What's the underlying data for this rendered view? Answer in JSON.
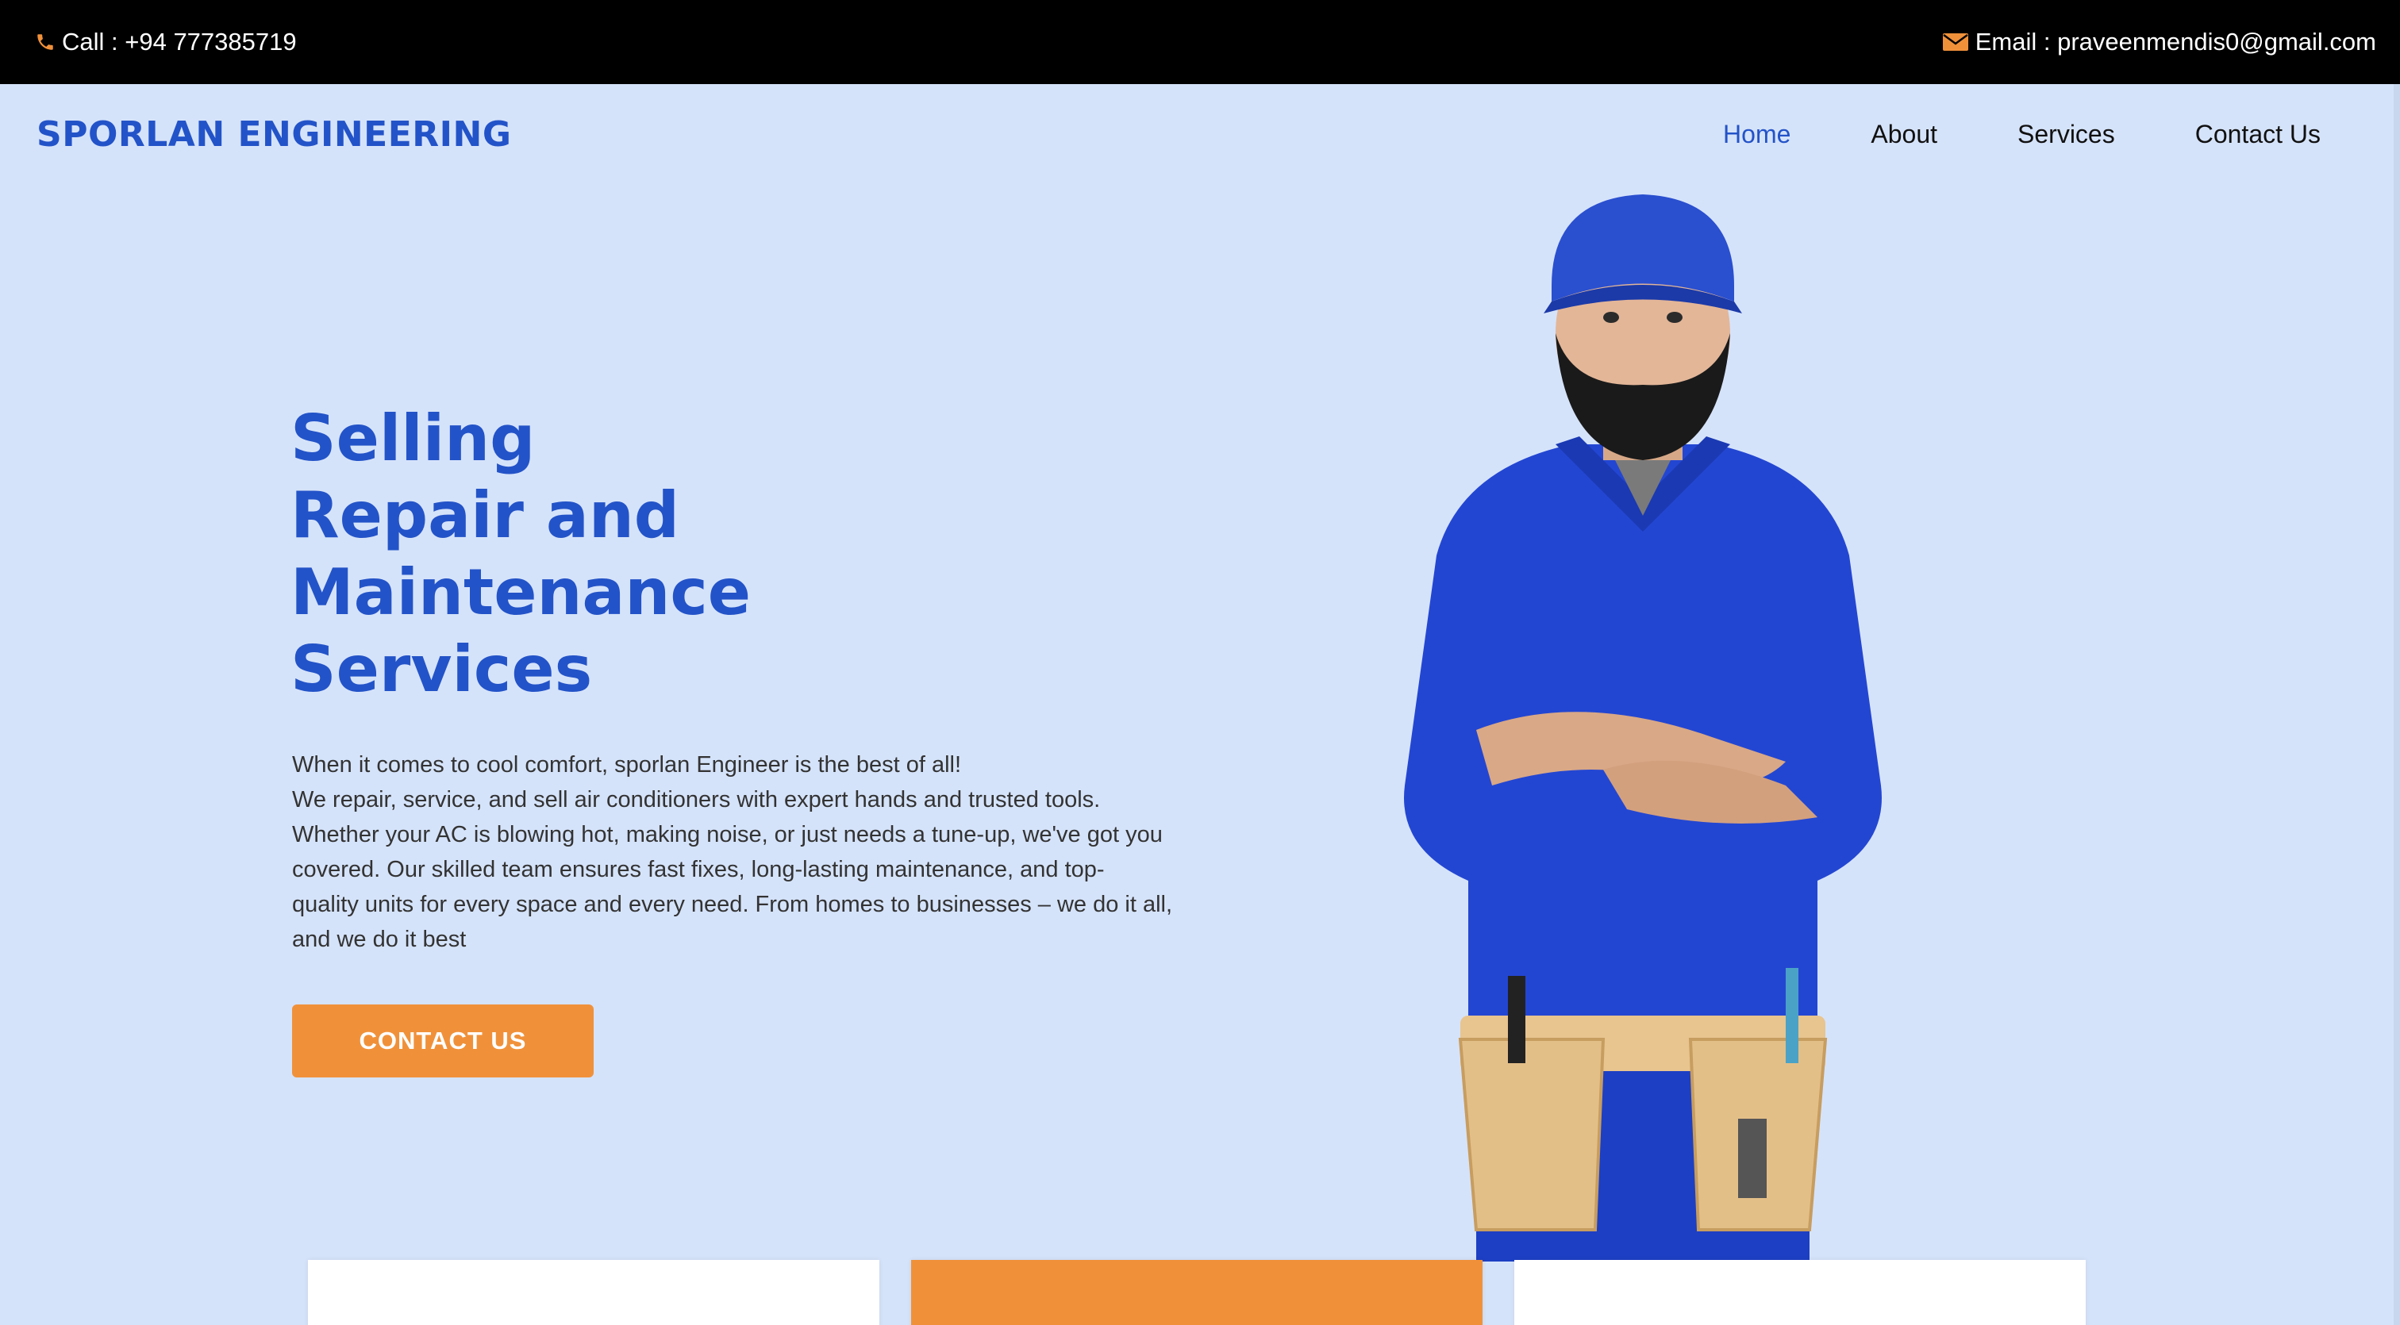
{
  "topbar": {
    "phone_icon": "phone-icon",
    "phone_text": "Call : +94 777385719",
    "email_icon": "envelope-icon",
    "email_text": "Email : praveenmendis0@gmail.com"
  },
  "nav": {
    "logo": "SPORLAN ENGINEERING",
    "items": [
      {
        "label": "Home",
        "active": true
      },
      {
        "label": "About",
        "active": false
      },
      {
        "label": "Services",
        "active": false
      },
      {
        "label": "Contact Us",
        "active": false
      }
    ]
  },
  "hero": {
    "title_lines": [
      "Selling",
      "Repair and",
      "Maintenance",
      "Services"
    ],
    "description_lines": [
      "When it comes to cool comfort, sporlan Engineer is the best of all!",
      "We repair, service, and sell air conditioners with expert hands and trusted tools.",
      "Whether your AC is blowing hot, making noise, or just needs a tune-up, we've got you",
      "covered. Our skilled team ensures fast fixes, long-lasting maintenance, and top-",
      "quality units for every space and every need. From homes to businesses – we do it all,",
      "and we do it best"
    ],
    "cta_label": "CONTACT US"
  },
  "colors": {
    "accent_blue": "#2353c8",
    "accent_orange": "#f0913a",
    "background": "#d5e3fa",
    "topbar": "#000000"
  }
}
